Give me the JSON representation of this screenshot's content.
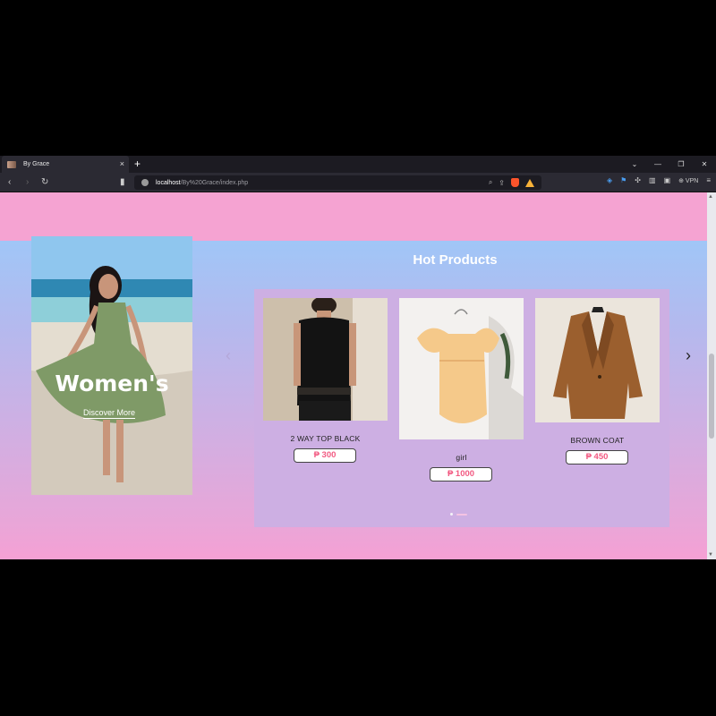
{
  "browser": {
    "tab_title": "By Grace",
    "tab_close": "×",
    "new_tab": "+",
    "url_host": "localhost",
    "url_path": "/By%20Grace/index.php",
    "vpn_label": "⊕ VPN",
    "icons": [
      "back-icon",
      "forward-icon",
      "reload-icon",
      "bookmark-icon",
      "site-info-icon",
      "zoom-icon",
      "share-icon",
      "brave-shields-icon",
      "brave-rewards-icon",
      "translate-icon",
      "extensions-icon",
      "sidebar-icon",
      "wallet-icon",
      "menu-icon"
    ]
  },
  "hero": {
    "title": "Women's",
    "link": "Discover More"
  },
  "hot_products": {
    "title": "Hot Products",
    "prev": "‹",
    "next": "›",
    "products": [
      {
        "name": "2 WAY TOP BLACK",
        "price": "₱ 300"
      },
      {
        "name": "girl",
        "price": "₱ 1000"
      },
      {
        "name": "BROWN COAT",
        "price": "₱ 450"
      }
    ],
    "pagination_count": 2,
    "active_page": 2
  },
  "colors": {
    "accent_pink": "#f5a3d2",
    "accent_blue": "#a0c6f7",
    "carousel_bg": "#cdafe3",
    "price_text": "#f25a82"
  }
}
